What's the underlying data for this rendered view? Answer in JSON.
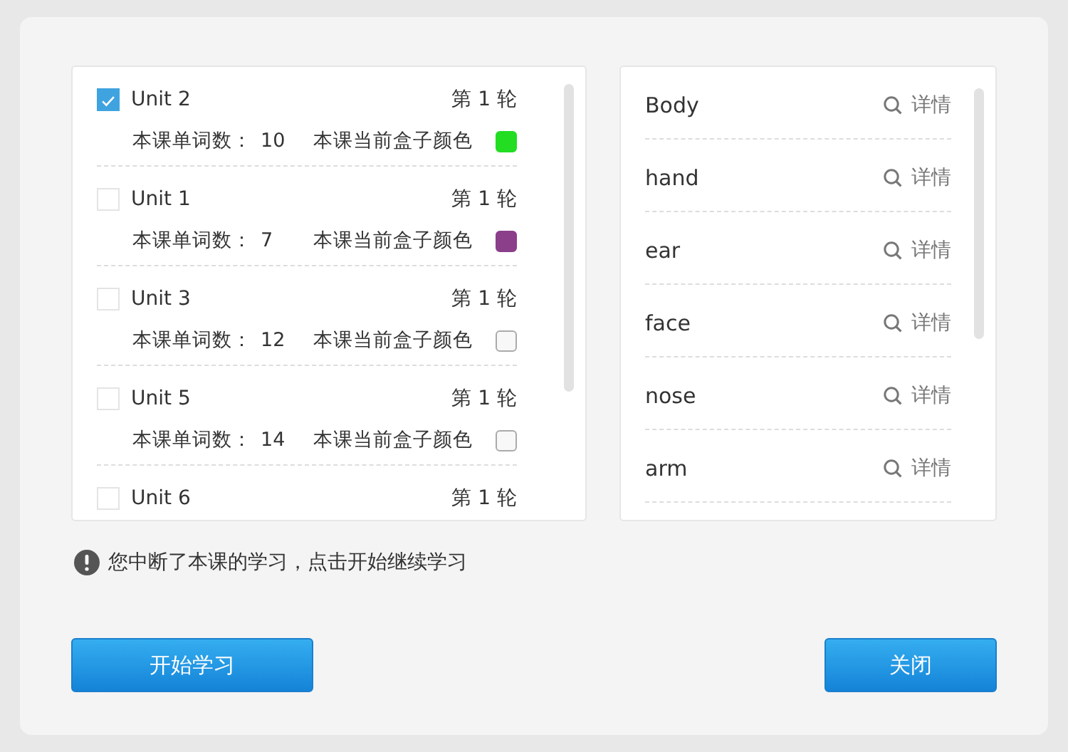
{
  "units": [
    {
      "name": "Unit 2",
      "checked": true,
      "round": "第 1 轮",
      "count_label": "本课单词数：",
      "count": "10",
      "color_label": "本课当前盒子颜色",
      "color": "#22dd22"
    },
    {
      "name": "Unit 1",
      "checked": false,
      "round": "第 1 轮",
      "count_label": "本课单词数：",
      "count": "7",
      "color_label": "本课当前盒子颜色",
      "color": "#8b3f8b"
    },
    {
      "name": "Unit 3",
      "checked": false,
      "round": "第 1 轮",
      "count_label": "本课单词数：",
      "count": "12",
      "color_label": "本课当前盒子颜色"
    },
    {
      "name": "Unit 5",
      "checked": false,
      "round": "第 1 轮",
      "count_label": "本课单词数：",
      "count": "14",
      "color_label": "本课当前盒子颜色"
    },
    {
      "name": "Unit 6",
      "checked": false,
      "round": "第 1 轮"
    }
  ],
  "words": [
    {
      "word": "Body",
      "action": "详情"
    },
    {
      "word": "hand",
      "action": "详情"
    },
    {
      "word": "ear",
      "action": "详情"
    },
    {
      "word": "face",
      "action": "详情"
    },
    {
      "word": "nose",
      "action": "详情"
    },
    {
      "word": "arm",
      "action": "详情"
    }
  ],
  "notice": "您中断了本课的学习，点击开始继续学习",
  "buttons": [
    "开始学习",
    "关闭"
  ]
}
